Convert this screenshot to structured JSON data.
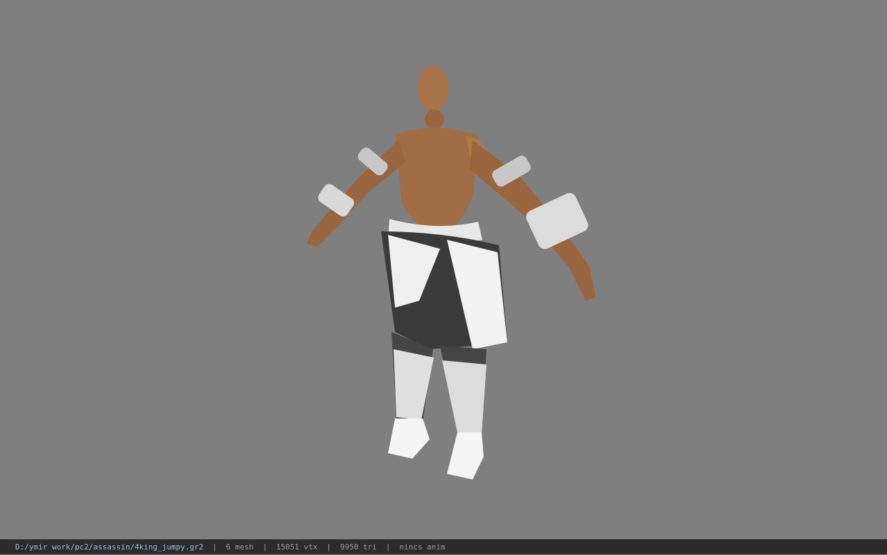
{
  "viewport": {
    "background": "#7f7f7f",
    "model_subject": "3d-character-model"
  },
  "statusbar": {
    "file_path": "D:/ymir work/pc2/assassin/4king_jumpy.gr2",
    "separator": "|",
    "mesh": "6 mesh",
    "vertices": "15051 vtx",
    "triangles": "9950 tri",
    "anim": "nincs anim"
  },
  "colors": {
    "path_text": "#8fc0e8",
    "stat_text": "#9a9a9a",
    "statusbar_bg": "#2b2b2b"
  }
}
